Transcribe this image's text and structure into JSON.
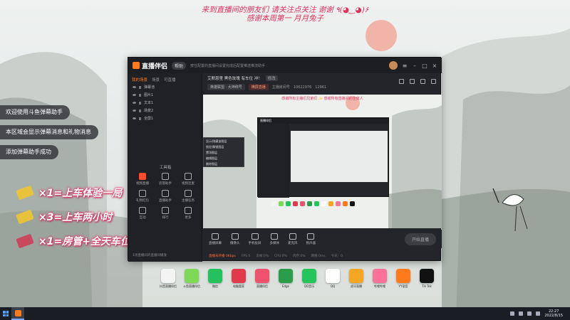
{
  "banner": {
    "line1": "来到直播间的朋友们 请关注点关注 谢谢 ٩(◕‿◕)۶",
    "line2": "感谢本周第一 月月兔子"
  },
  "chat": [
    "欢迎使用斗鱼弹幕助手",
    "本区域会显示弹幕消息和礼物消息",
    "添加弹幕助手成功"
  ],
  "rules": [
    {
      "text": "×1=上车体验一局",
      "icon_color": "#e8c23a"
    },
    {
      "text": "×3=上车两小时",
      "icon_color": "#e8c23a"
    },
    {
      "text": "×1=房管+全天车位",
      "icon_color": "#c8485e"
    }
  ],
  "app": {
    "name": "直播伴侣",
    "badge": "帮助",
    "notice": "按住配置的直播间设置完成后配置推送推流助手",
    "left_tabs": [
      "我的场景",
      "场景",
      "可直播"
    ],
    "layers": [
      "弹幕池",
      "图片1",
      "文本1",
      "场景2",
      "全屏1"
    ],
    "toolbox_title": "工具箱",
    "tools": [
      "视频直播",
      "房管助手",
      "视频连麦",
      "礼物红包",
      "直播助手",
      "主播任务",
      "互动",
      "排行",
      "更多"
    ],
    "bottom_tip": "1场直播间的直播间播放",
    "stream": {
      "title": "艾默恩里 黑色玫瑰 有车位 冲！",
      "tag": "修改",
      "category": "英雄联盟 · 大神称号",
      "mode": "横屏直播",
      "room_label": "主播房间号",
      "room_id": "10622976",
      "fans": "12961"
    },
    "preview_caption": "感谢所有主播们兄弟们 ✨ 感谢所有直播间的全体人",
    "context_menu": [
      "显示/隐藏该图层",
      "锁定/解锁图层",
      "置顶图层",
      "编辑图层",
      "删除图层"
    ],
    "controls": [
      "直播屏幕",
      "摄像头",
      "手机投屏",
      "多媒体",
      "麦克风",
      "扬声器"
    ],
    "start_label": "开始直播",
    "status": [
      "直播未开播 0Kbps",
      "FPS:0",
      "丢帧:0%",
      "CPU:0%",
      "内存:0%",
      "网络:0ms",
      "今天：0"
    ]
  },
  "desktop_icons": [
    {
      "label": "抖音直播伴侣",
      "color": "#f4f4f4"
    },
    {
      "label": "斗鱼直播伴侣",
      "color": "#7ed957"
    },
    {
      "label": "微信",
      "color": "#22c35d"
    },
    {
      "label": "电脑管家",
      "color": "#e23a4a"
    },
    {
      "label": "直播伴侣",
      "color": "#f0516c"
    },
    {
      "label": "Edge",
      "color": "#2a9d4a"
    },
    {
      "label": "QQ音乐",
      "color": "#24c65c"
    },
    {
      "label": "QQ",
      "color": "#ffffff"
    },
    {
      "label": "虎牙直播",
      "color": "#f5a623"
    },
    {
      "label": "哔哩哔哩",
      "color": "#fb7299"
    },
    {
      "label": "YY语音",
      "color": "#ff7a1a"
    },
    {
      "label": "Tik Tok",
      "color": "#111111"
    }
  ],
  "clock": {
    "time": "22:27",
    "date": "2022/8/15"
  }
}
